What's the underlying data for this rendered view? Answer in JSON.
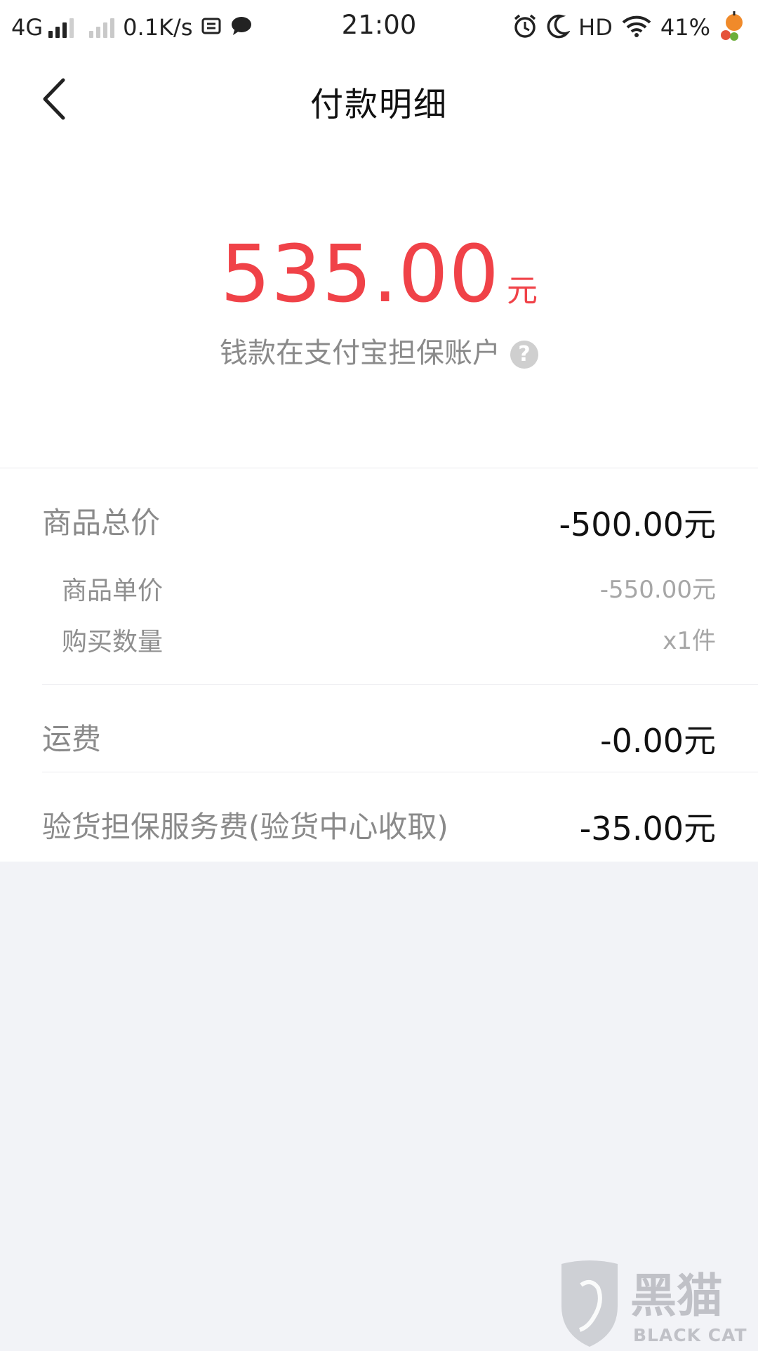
{
  "status_bar": {
    "network": "4G",
    "speed": "0.1K/s",
    "time": "21:00",
    "hd": "HD",
    "battery": "41%"
  },
  "header": {
    "title": "付款明细"
  },
  "summary": {
    "amount": "535.00",
    "unit": "元",
    "escrow_text": "钱款在支付宝担保账户",
    "help_symbol": "?"
  },
  "details": {
    "goods_total": {
      "label": "商品总价",
      "value": "-500.00元"
    },
    "unit_price": {
      "label": "商品单价",
      "value": "-550.00元"
    },
    "quantity": {
      "label": "购买数量",
      "value": "x1件"
    },
    "shipping": {
      "label": "运费",
      "value": "-0.00元"
    },
    "inspection_fee": {
      "label": "验货担保服务费(验货中心收取)",
      "value": "-35.00元"
    }
  },
  "watermark": {
    "cn": "黑猫",
    "en": "BLACK CAT"
  },
  "colors": {
    "accent_red": "#f04248",
    "page_background": "#f2f3f7",
    "muted_text": "#8a8a8a"
  },
  "icons": [
    "chevron-left-icon",
    "help-icon",
    "alarm-icon",
    "moon-icon",
    "wifi-icon",
    "signal-icon",
    "chat-icon",
    "screenshot-icon"
  ]
}
